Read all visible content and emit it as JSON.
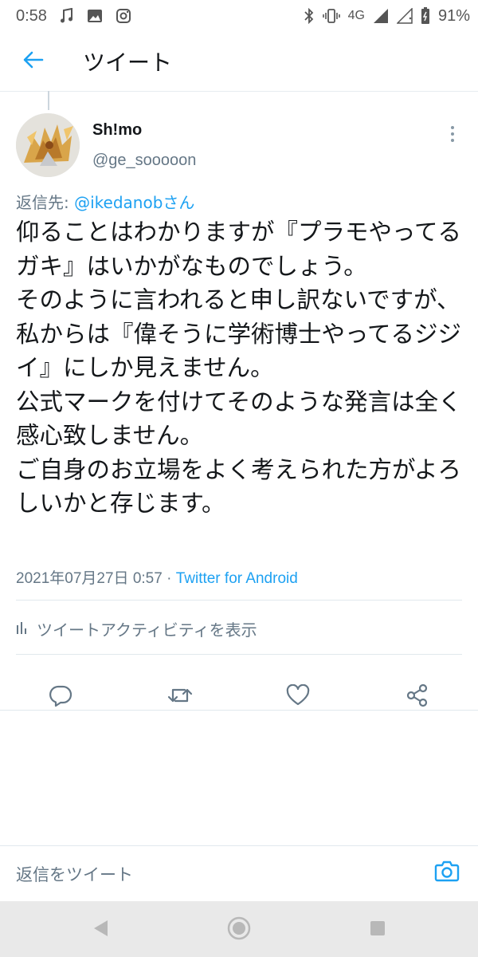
{
  "status_bar": {
    "time": "0:58",
    "network": "4G",
    "battery": "91%",
    "left_icons": [
      "music-icon",
      "image-icon",
      "instagram-icon"
    ],
    "right_icons": [
      "bluetooth-icon",
      "vibrate-icon",
      "signal-icon",
      "battery-icon"
    ]
  },
  "header": {
    "title": "ツイート",
    "back_icon": "arrow-left-icon"
  },
  "tweet": {
    "user_name": "Sh!mo",
    "user_handle": "@ge_sooooon",
    "reply_prefix": "返信先: ",
    "reply_mention": "@ikedanobさん",
    "text": "仰ることはわかりますが『プラモやってるガキ』はいかがなものでしょう。\nそのように言われると申し訳ないですが、私からは『偉そうに学術博士やってるジジイ』にしか見えません。\n公式マークを付けてそのような発言は全く感心致しません。\nご自身のお立場をよく考えられた方がよろしいかと存じます。",
    "timestamp": "2021年07月27日 0:57",
    "separator": " · ",
    "source": "Twitter for Android",
    "activity_label": "ツイートアクティビティを表示"
  },
  "actions": [
    "reply-icon",
    "retweet-icon",
    "like-icon",
    "share-icon"
  ],
  "reply_bar": {
    "placeholder": "返信をツイート",
    "camera_icon": "camera-icon"
  },
  "nav_bar": [
    "back-triangle-icon",
    "home-circle-icon",
    "recents-square-icon"
  ],
  "colors": {
    "accent": "#1da1f2",
    "secondary_text": "#657786",
    "primary_text": "#14171a"
  }
}
